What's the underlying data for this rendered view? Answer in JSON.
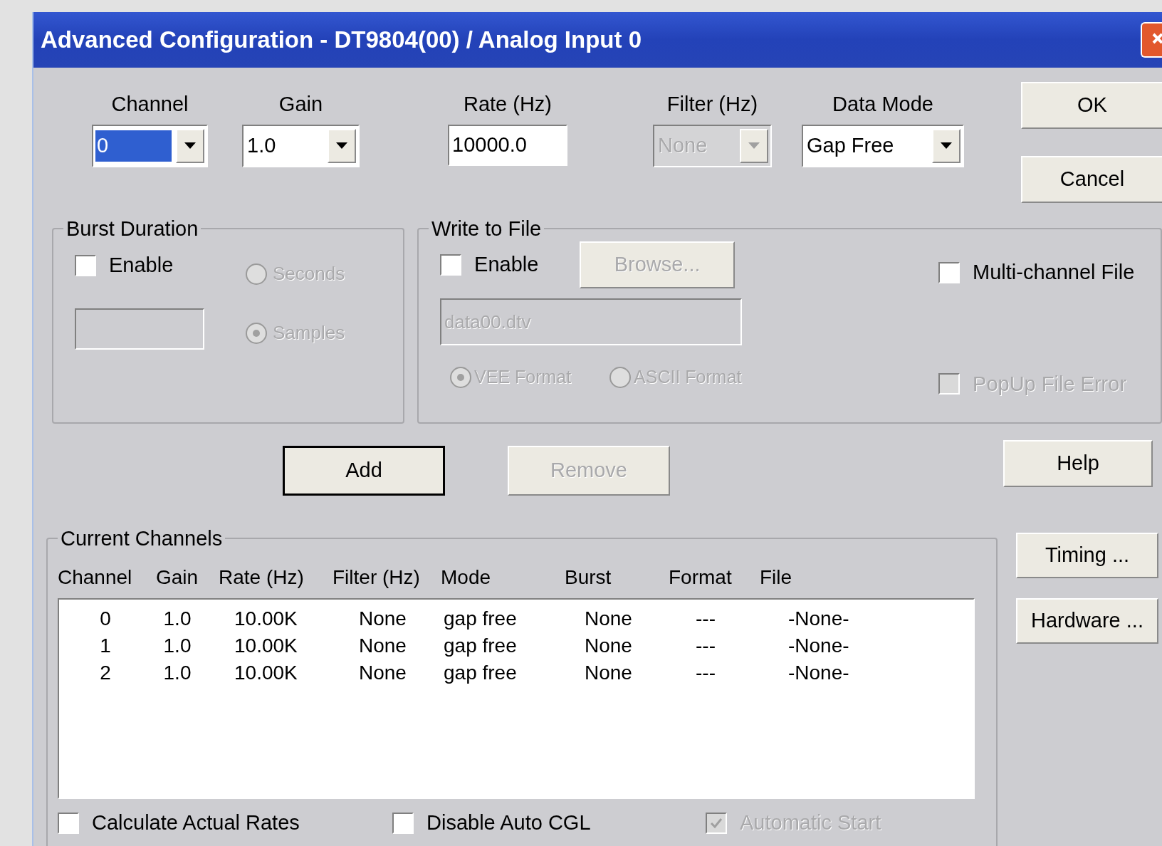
{
  "window": {
    "title": "Advanced Configuration - DT9804(00) / Analog Input 0"
  },
  "settings": [
    {
      "label": "Channel",
      "kind": "combo",
      "value": "0",
      "disabled": false,
      "highlighted": true
    },
    {
      "label": "Gain",
      "kind": "combo",
      "value": "1.0",
      "disabled": false,
      "highlighted": false
    },
    {
      "label": "Rate (Hz)",
      "kind": "input",
      "value": "10000.0",
      "disabled": false,
      "highlighted": false
    },
    {
      "label": "Filter (Hz)",
      "kind": "combo",
      "value": "None",
      "disabled": true,
      "highlighted": false
    },
    {
      "label": "Data Mode",
      "kind": "combo",
      "value": "Gap Free",
      "disabled": false,
      "highlighted": false
    }
  ],
  "dialog_buttons": [
    "OK",
    "Cancel"
  ],
  "burst_duration": {
    "title": "Burst Duration",
    "enable": {
      "label": "Enable",
      "checked": false
    },
    "field_disabled": true,
    "units": [
      {
        "label": "Seconds",
        "selected": false,
        "disabled": true
      },
      {
        "label": "Samples",
        "selected": true,
        "disabled": true
      }
    ]
  },
  "write_to_file": {
    "title": "Write to File",
    "enable": {
      "label": "Enable",
      "checked": false
    },
    "browse": {
      "label": "Browse...",
      "disabled": true
    },
    "file_name": {
      "value": "data00.dtv",
      "disabled": true
    },
    "formats": [
      {
        "label": "VEE Format",
        "selected": true,
        "disabled": true
      },
      {
        "label": "ASCII Format",
        "selected": false,
        "disabled": true
      }
    ],
    "multi_channel": {
      "label": "Multi-channel File",
      "checked": false,
      "disabled": false
    },
    "popup_error": {
      "label": "PopUp File Error",
      "checked": false,
      "disabled": true
    }
  },
  "actions": [
    {
      "label": "Add",
      "disabled": false,
      "default": true
    },
    {
      "label": "Remove",
      "disabled": true,
      "default": false
    }
  ],
  "help_button": "Help",
  "current_channels": {
    "title": "Current Channels",
    "columns": [
      "Channel",
      "Gain",
      "Rate (Hz)",
      "Filter (Hz)",
      "Mode",
      "Burst",
      "Format",
      "File"
    ],
    "rows": [
      [
        "0",
        "1.0",
        "10.00K",
        "None",
        "gap free",
        "None",
        "---",
        "-None-"
      ],
      [
        "1",
        "1.0",
        "10.00K",
        "None",
        "gap free",
        "None",
        "---",
        "-None-"
      ],
      [
        "2",
        "1.0",
        "10.00K",
        "None",
        "gap free",
        "None",
        "---",
        "-None-"
      ]
    ],
    "options": [
      {
        "label": "Calculate Actual Rates",
        "checked": false,
        "disabled": false
      },
      {
        "label": "Disable Auto CGL",
        "checked": false,
        "disabled": false
      },
      {
        "label": "Automatic Start",
        "checked": true,
        "disabled": true
      }
    ]
  },
  "side_buttons": [
    "Timing ...",
    "Hardware ..."
  ]
}
